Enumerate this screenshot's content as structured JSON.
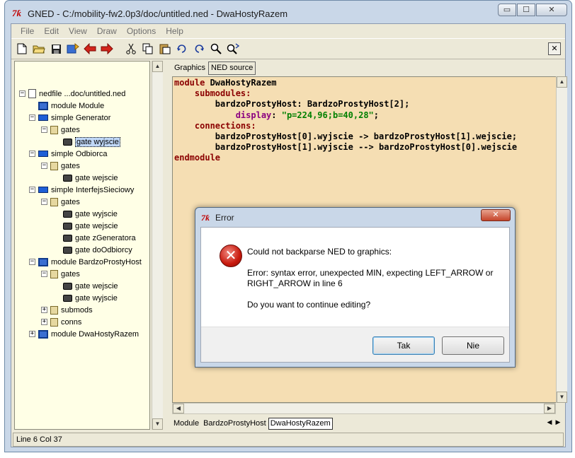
{
  "window": {
    "title": "GNED - C:/mobility-fw2.0p3/doc/untitled.ned - DwaHostyRazem",
    "icon": "tk-icon",
    "min_glyph": "▭",
    "max_glyph": "☐",
    "close_glyph": "✕"
  },
  "menubar": {
    "items": [
      "File",
      "Edit",
      "View",
      "Draw",
      "Options",
      "Help"
    ]
  },
  "toolbar": {
    "icons": [
      "new-file-icon",
      "open-folder-icon",
      "save-icon",
      "import-icon",
      "back-arrow-icon",
      "forward-arrow-icon",
      "cut-icon",
      "copy-icon",
      "paste-icon",
      "undo-icon",
      "redo-icon",
      "find-icon",
      "find-replace-icon"
    ],
    "close_glyph": "✕"
  },
  "tree": {
    "items": [
      {
        "label": "nedfile ...doc/untitled.ned",
        "icon": "file-icon",
        "level": 0,
        "toggle": "−"
      },
      {
        "label": "module Module",
        "icon": "module-icon",
        "level": 1,
        "toggle": ""
      },
      {
        "label": "simple Generator",
        "icon": "simple-icon",
        "level": 1,
        "toggle": "−"
      },
      {
        "label": "gates",
        "icon": "gates-icon",
        "level": 2,
        "toggle": "−"
      },
      {
        "label": "gate wyjscie",
        "icon": "gate-icon",
        "level": 3,
        "toggle": "",
        "selected": true
      },
      {
        "label": "simple Odbiorca",
        "icon": "simple-icon",
        "level": 1,
        "toggle": "−"
      },
      {
        "label": "gates",
        "icon": "gates-icon",
        "level": 2,
        "toggle": "−"
      },
      {
        "label": "gate wejscie",
        "icon": "gate-icon",
        "level": 3,
        "toggle": ""
      },
      {
        "label": "simple InterfejsSieciowy",
        "icon": "simple-icon",
        "level": 1,
        "toggle": "−"
      },
      {
        "label": "gates",
        "icon": "gates-icon",
        "level": 2,
        "toggle": "−"
      },
      {
        "label": "gate wyjscie",
        "icon": "gate-icon",
        "level": 3,
        "toggle": ""
      },
      {
        "label": "gate wejscie",
        "icon": "gate-icon",
        "level": 3,
        "toggle": ""
      },
      {
        "label": "gate zGeneratora",
        "icon": "gate-icon",
        "level": 3,
        "toggle": ""
      },
      {
        "label": "gate doOdbiorcy",
        "icon": "gate-icon",
        "level": 3,
        "toggle": ""
      },
      {
        "label": "module BardzoProstyHost",
        "icon": "module-icon",
        "level": 1,
        "toggle": "−"
      },
      {
        "label": "gates",
        "icon": "gates-icon",
        "level": 2,
        "toggle": "−"
      },
      {
        "label": "gate wejscie",
        "icon": "gate-icon",
        "level": 3,
        "toggle": ""
      },
      {
        "label": "gate wyjscie",
        "icon": "gate-icon",
        "level": 3,
        "toggle": ""
      },
      {
        "label": "submods",
        "icon": "gates-icon",
        "level": 2,
        "toggle": "+"
      },
      {
        "label": "conns",
        "icon": "gates-icon",
        "level": 2,
        "toggle": "+"
      },
      {
        "label": "module DwaHostyRazem",
        "icon": "module-icon",
        "level": 1,
        "toggle": "+"
      }
    ]
  },
  "tabs": {
    "graphics": "Graphics",
    "ned_source": "NED source"
  },
  "editor": {
    "lines": [
      {
        "indent": "",
        "parts": [
          {
            "t": "module ",
            "c": "kw"
          },
          {
            "t": "DwaHostyRazem",
            "c": "id"
          }
        ]
      },
      {
        "indent": "    ",
        "parts": [
          {
            "t": "submodules:",
            "c": "kw"
          }
        ]
      },
      {
        "indent": "        ",
        "parts": [
          {
            "t": "bardzoProstyHost: BardzoProstyHost[2];",
            "c": "id"
          }
        ]
      },
      {
        "indent": "            ",
        "parts": [
          {
            "t": "display",
            "c": "prop"
          },
          {
            "t": ": ",
            "c": "id"
          },
          {
            "t": "\"p=224,96;b=40,28\"",
            "c": "str"
          },
          {
            "t": ";",
            "c": "id"
          }
        ]
      },
      {
        "indent": "    ",
        "parts": [
          {
            "t": "connections:",
            "c": "kw"
          }
        ]
      },
      {
        "indent": "        ",
        "parts": [
          {
            "t": "bardzoProstyHost[0].wyjscie -> bardzoProstyHost[1].wejscie;",
            "c": "id"
          }
        ]
      },
      {
        "indent": "        ",
        "parts": [
          {
            "t": "bardzoProstyHost[1].wyjscie --> bardzoProstyHost[0].wejscie",
            "c": "id"
          }
        ]
      },
      {
        "indent": "",
        "parts": [
          {
            "t": "endmodule",
            "c": "kw"
          }
        ]
      }
    ]
  },
  "bottom_tabs": {
    "module_label": "Module",
    "items": [
      "BardzoProstyHost",
      "DwaHostyRazem"
    ],
    "active": "DwaHostyRazem"
  },
  "status": {
    "text": "Line 6 Col 37"
  },
  "dialog": {
    "title": "Error",
    "close_glyph": "✕",
    "icon": "error-icon",
    "icon_glyph": "✕",
    "line1": "Could not backparse NED to graphics:",
    "line2": "Error: syntax error, unexpected MIN, expecting LEFT_ARROW or",
    "line3": "RIGHT_ARROW in line 6",
    "line4": "Do you want to continue editing?",
    "yes_label": "Tak",
    "no_label": "Nie"
  },
  "glyphs": {
    "up": "▲",
    "down": "▼",
    "left": "◀",
    "right": "▶"
  },
  "colors": {
    "tree_bg": "#ffffe6",
    "editor_bg": "#f5deb3",
    "keyword": "#8b0000",
    "string": "#008000",
    "property": "#8b0080"
  }
}
